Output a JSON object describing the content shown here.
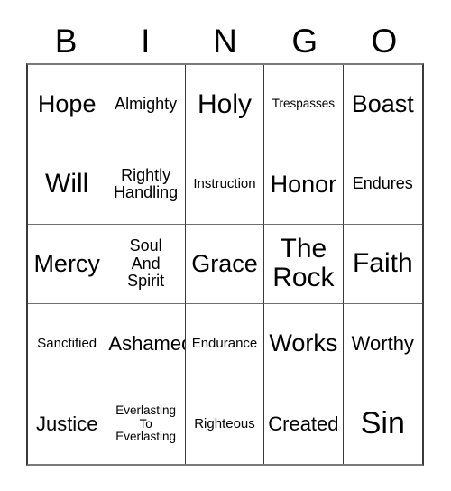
{
  "card": {
    "type": "bingo-card",
    "columns": 5,
    "rows": 5,
    "background_color": "#ffffff",
    "text_color": "#000000",
    "border_color": "#3a3a3a"
  },
  "header": {
    "letters": [
      {
        "label": "B"
      },
      {
        "label": "I"
      },
      {
        "label": "N"
      },
      {
        "label": "G"
      },
      {
        "label": "O"
      }
    ]
  },
  "grid": {
    "cells": [
      {
        "label": "Hope",
        "size": "fs-lg"
      },
      {
        "label": "Almighty",
        "size": "fs-sm"
      },
      {
        "label": "Holy",
        "size": "fs-xl"
      },
      {
        "label": "Trespasses",
        "size": "fs-xxs"
      },
      {
        "label": "Boast",
        "size": "fs-lg"
      },
      {
        "label": "Will",
        "size": "fs-xl"
      },
      {
        "label": "Rightly\nHandling",
        "size": "fs-sm"
      },
      {
        "label": "Instruction",
        "size": "fs-xs"
      },
      {
        "label": "Honor",
        "size": "fs-lg"
      },
      {
        "label": "Endures",
        "size": "fs-sm"
      },
      {
        "label": "Mercy",
        "size": "fs-lg"
      },
      {
        "label": "Soul\nAnd\nSpirit",
        "size": "fs-sm"
      },
      {
        "label": "Grace",
        "size": "fs-lg"
      },
      {
        "label": "The\nRock",
        "size": "fs-xl"
      },
      {
        "label": "Faith",
        "size": "fs-xl"
      },
      {
        "label": "Sanctified",
        "size": "fs-xs"
      },
      {
        "label": "Ashamed",
        "size": "fs-md"
      },
      {
        "label": "Endurance",
        "size": "fs-xs"
      },
      {
        "label": "Works",
        "size": "fs-lg"
      },
      {
        "label": "Worthy",
        "size": "fs-md"
      },
      {
        "label": "Justice",
        "size": "fs-md"
      },
      {
        "label": "Everlasting\nTo\nEverlasting",
        "size": "fs-xxs"
      },
      {
        "label": "Righteous",
        "size": "fs-xs"
      },
      {
        "label": "Created",
        "size": "fs-md"
      },
      {
        "label": "Sin",
        "size": "fs-xxl"
      }
    ]
  }
}
